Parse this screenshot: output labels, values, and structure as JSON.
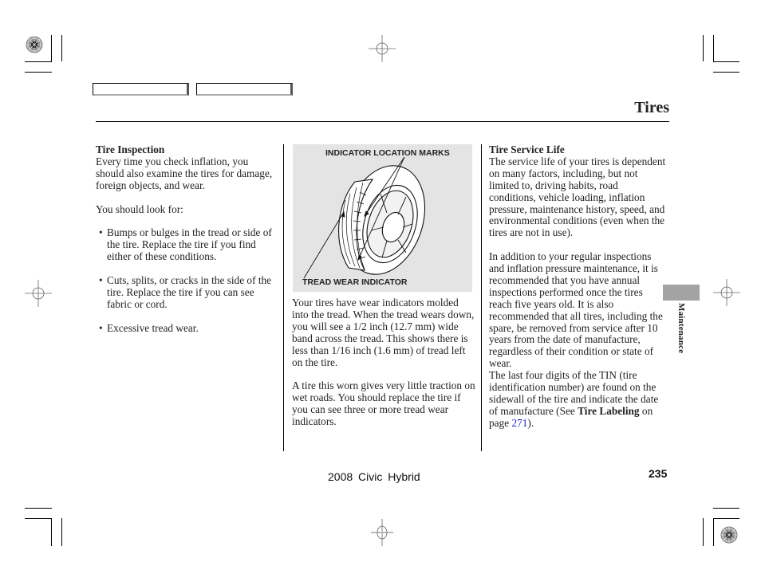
{
  "page": {
    "title": "Tires",
    "side_tab_label": "Maintenance",
    "footer_model": "2008  Civic  Hybrid",
    "page_number": "235",
    "colors": {
      "side_tab": "#a3a3a3",
      "figure_bg": "#e4e4e4",
      "link": "#2222cc"
    }
  },
  "left_column": {
    "heading": "Tire Inspection",
    "intro": "Every time you check inflation, you should also examine the tires for damage, foreign objects, and wear.",
    "lead": "You should look for:",
    "bullets": [
      "Bumps or bulges in the tread or side of the tire. Replace the tire if you find either of these conditions.",
      "Cuts, splits, or cracks in the side of the tire. Replace the tire if you can see fabric or cord.",
      "Excessive tread wear."
    ]
  },
  "middle_column": {
    "figure": {
      "label_top": "INDICATOR LOCATION MARKS",
      "label_bottom": "TREAD WEAR INDICATOR"
    },
    "paragraphs": [
      "Your tires have wear indicators molded into the tread. When the tread wears down, you will see a 1/2 inch (12.7 mm) wide band across the tread. This shows there is less than 1/16 inch (1.6 mm) of tread left on the tire.",
      "A tire this worn gives very little traction on wet roads. You should replace the tire if you can see three or more tread wear indicators."
    ]
  },
  "right_column": {
    "heading": "Tire Service Life",
    "para1": "The service life of your tires is dependent on many factors, including, but not limited to, driving habits, road conditions, vehicle loading, inflation pressure, maintenance history, speed, and environmental conditions (even when the tires are not in use).",
    "para2": "In addition to your regular inspections and inflation pressure maintenance, it is recommended that you have annual inspections performed once the tires reach five years old. It is also recommended that all tires, including the spare, be removed from service after 10 years from the date of manufacture, regardless of their condition or state of wear.",
    "para3_text": "The last four digits of the TIN (tire identification number) are found on the sidewall of the tire and indicate the date of manufacture (See ",
    "para3_bold": "Tire Labeling",
    "para3_mid": " on page ",
    "para3_link": "271",
    "para3_end": ")."
  }
}
